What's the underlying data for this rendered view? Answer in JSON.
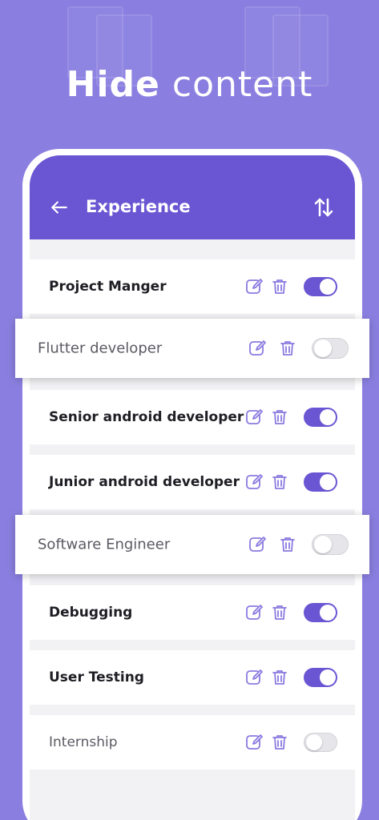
{
  "headline": {
    "bold": "Hide",
    "rest": "content"
  },
  "appbar": {
    "title": "Experience",
    "back_icon": "arrow-left-icon",
    "sort_icon": "sort-arrows-icon"
  },
  "colors": {
    "background": "#8a7fe0",
    "primary": "#6a55d3",
    "icon": "#8b7ae0",
    "toggle_off": "#e6e6ea"
  },
  "items": [
    {
      "label": "Project Manger",
      "visible": true
    },
    {
      "label": "Flutter developer",
      "visible": false
    },
    {
      "label": "Senior android developer",
      "visible": true
    },
    {
      "label": "Junior android developer",
      "visible": true
    },
    {
      "label": "Software Engineer",
      "visible": false
    },
    {
      "label": "Debugging",
      "visible": true
    },
    {
      "label": "User Testing",
      "visible": true
    },
    {
      "label": "Internship",
      "visible": false
    }
  ]
}
